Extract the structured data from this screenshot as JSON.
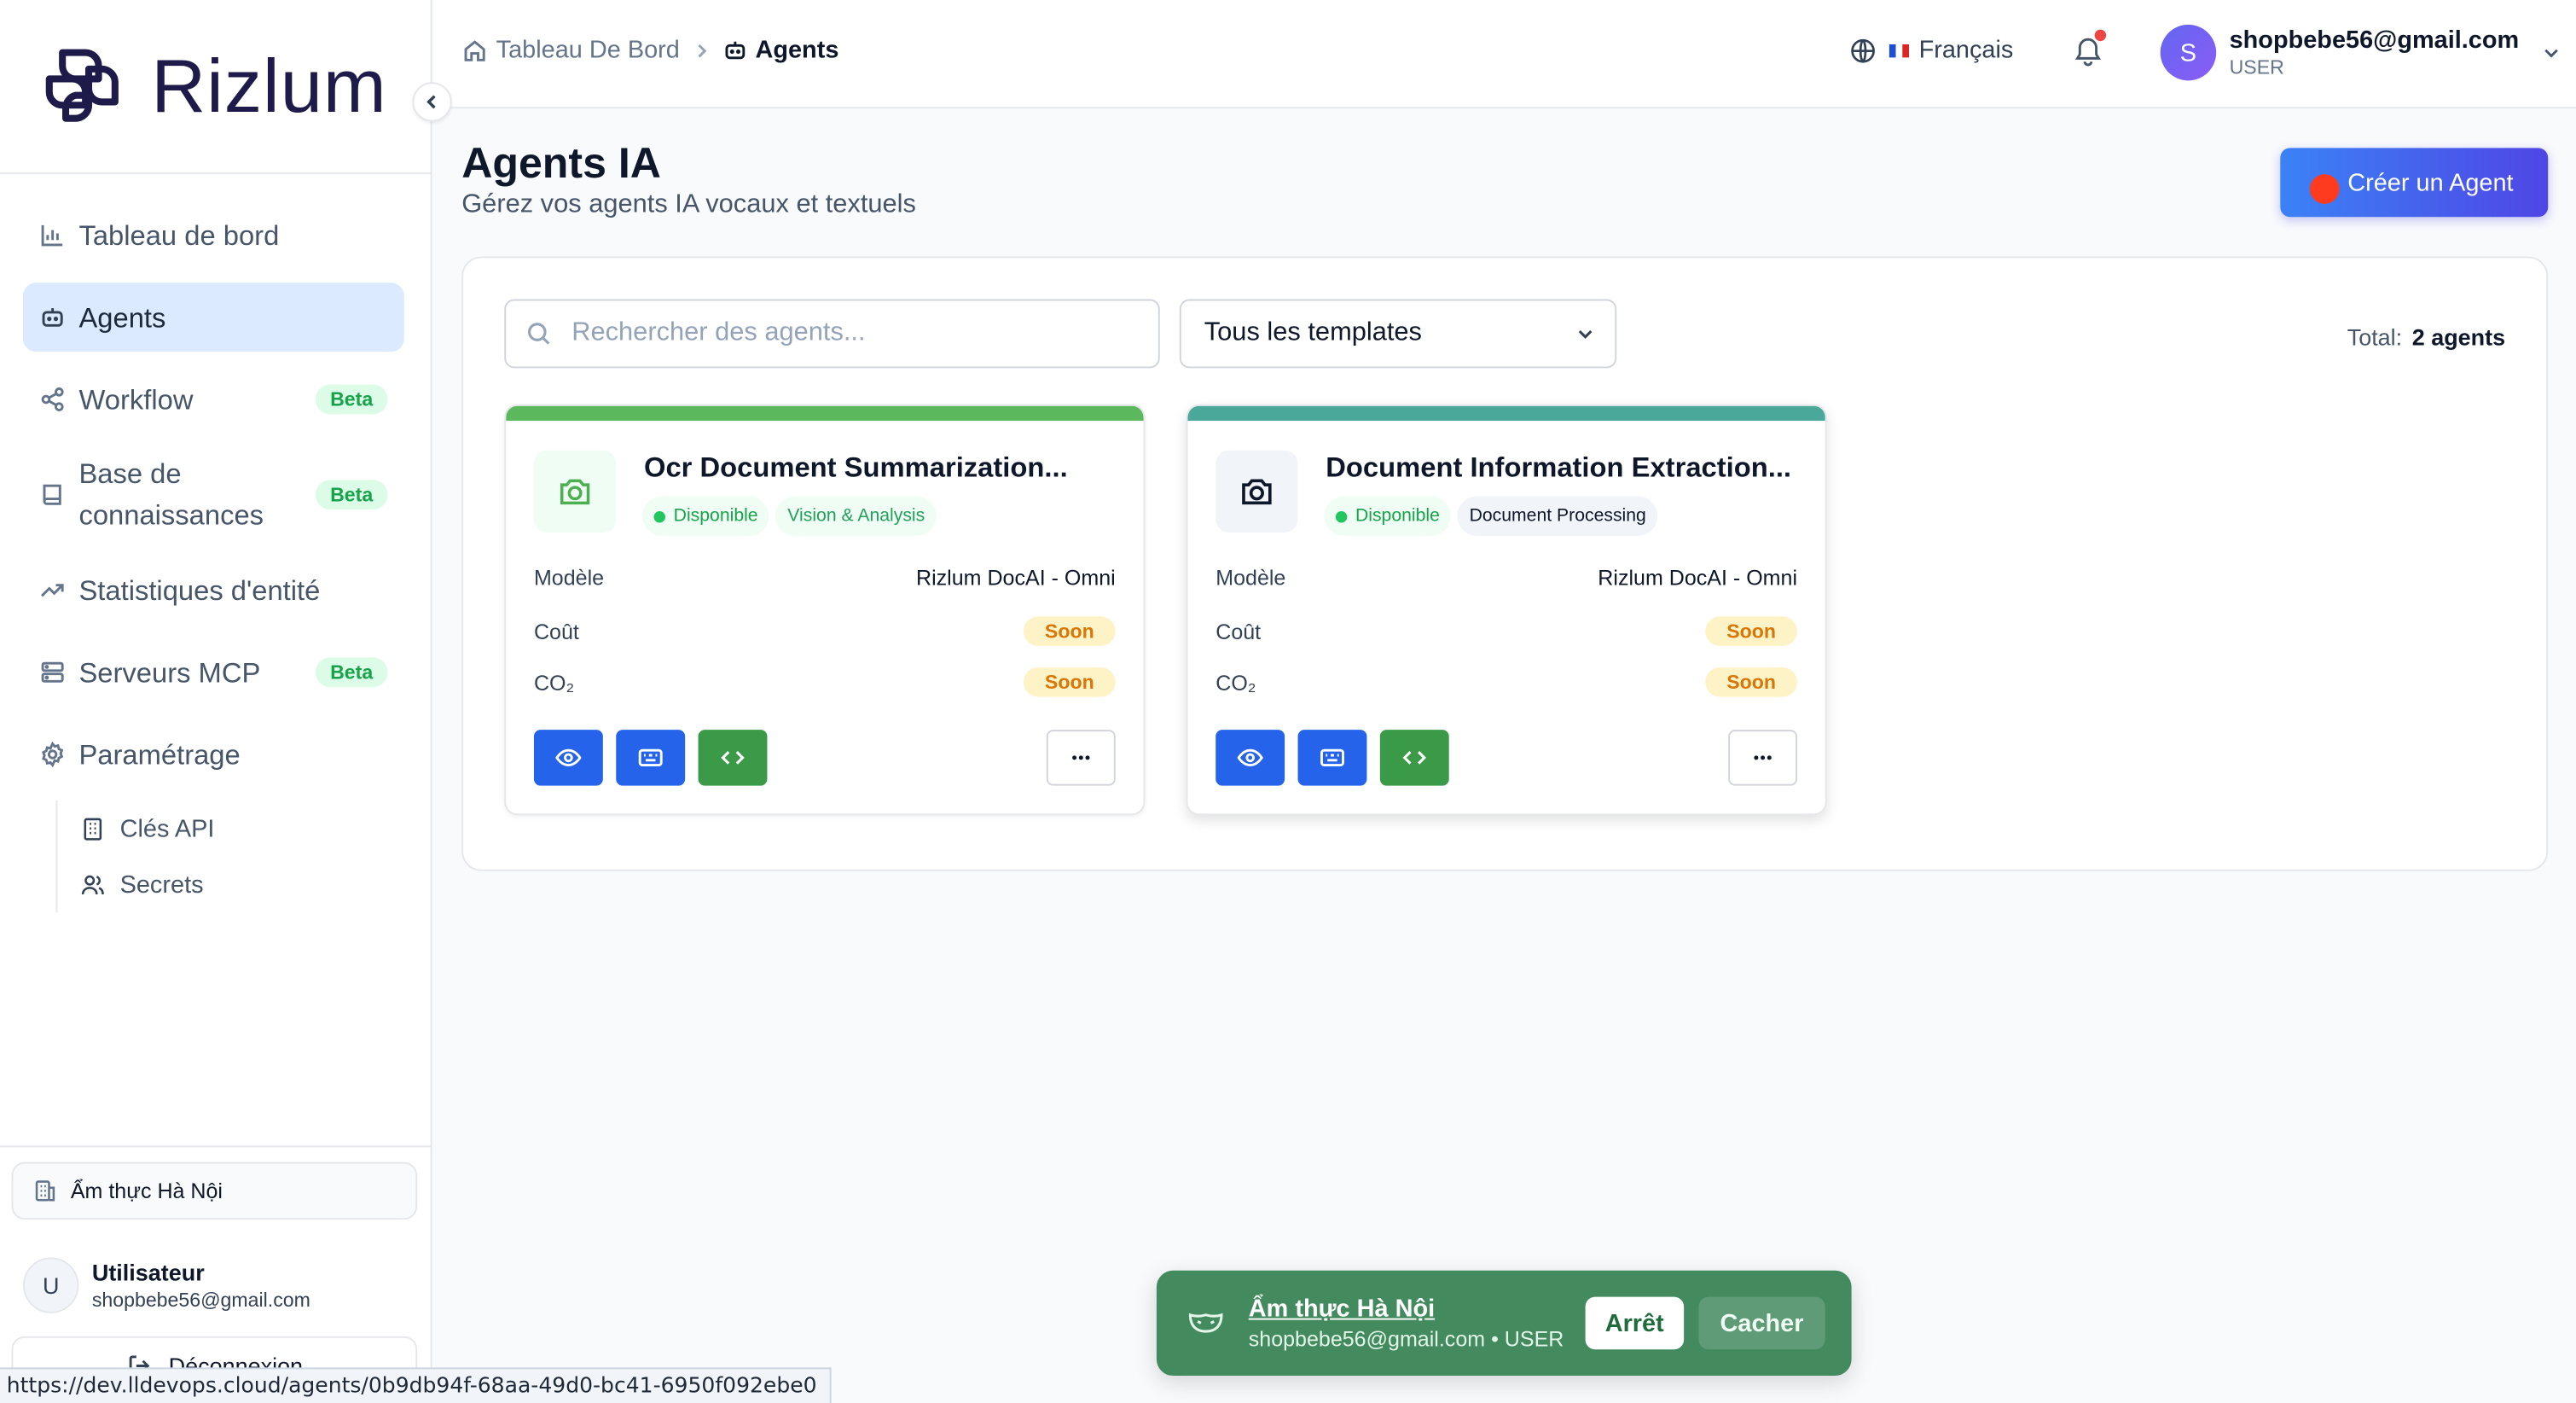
{
  "app": {
    "name": "Rizlum"
  },
  "sidebar": {
    "items": [
      {
        "label": "Tableau de bord",
        "icon": "bar-chart-icon"
      },
      {
        "label": "Agents",
        "icon": "bot-icon",
        "active": true
      },
      {
        "label": "Workflow",
        "icon": "share-icon",
        "badge": "Beta"
      },
      {
        "label": "Base de connaissances",
        "icon": "book-icon",
        "badge": "Beta"
      },
      {
        "label": "Statistiques d'entité",
        "icon": "trending-icon"
      },
      {
        "label": "Serveurs MCP",
        "icon": "server-icon",
        "badge": "Beta"
      },
      {
        "label": "Paramétrage",
        "icon": "gear-icon"
      }
    ],
    "sub_items": [
      {
        "label": "Clés API",
        "icon": "building-icon"
      },
      {
        "label": "Secrets",
        "icon": "users-icon"
      }
    ],
    "organization": "Ẩm thực Hà Nội",
    "user": {
      "initial": "U",
      "name": "Utilisateur",
      "email": "shopbebe56@gmail.com"
    },
    "logout_label": "Déconnexion"
  },
  "status_url": "https://dev.lldevops.cloud/agents/0b9db94f-68aa-49d0-bc41-6950f092ebe0",
  "header": {
    "breadcrumb": {
      "home": "Tableau De Bord",
      "current": "Agents"
    },
    "language": "Français",
    "user": {
      "initial": "S",
      "email": "shopbebe56@gmail.com",
      "role": "USER"
    }
  },
  "main": {
    "title": "Agents IA",
    "subtitle": "Gérez vos agents IA vocaux et textuels",
    "create_button": "Créer un Agent",
    "search_placeholder": "Rechercher des agents...",
    "template_select": "Tous les templates",
    "total_label": "Total:",
    "total_value": "2 agents",
    "labels": {
      "model": "Modèle",
      "cost": "Coût",
      "co2": "CO₂"
    },
    "agents": [
      {
        "title": "Ocr Document Summarization...",
        "status": "Disponible",
        "category": "Vision & Analysis",
        "model": "Rizlum DocAI - Omni",
        "cost": "Soon",
        "co2": "Soon",
        "accent_color": "#5cb85c",
        "icon_color": "#4caf50"
      },
      {
        "title": "Document Information Extraction...",
        "status": "Disponible",
        "category": "Document Processing",
        "model": "Rizlum DocAI - Omni",
        "cost": "Soon",
        "co2": "Soon",
        "accent_color": "#4aa89a",
        "icon_color": "#0f172a"
      }
    ]
  },
  "toast": {
    "org": "Ẩm thực Hà Nội",
    "details": "shopbebe56@gmail.com • USER",
    "stop_label": "Arrêt",
    "hide_label": "Cacher"
  },
  "colors": {
    "primary": "#2563eb",
    "success": "#3b9a48",
    "toast_bg": "#438a5e",
    "active_nav": "#dbeafe"
  }
}
